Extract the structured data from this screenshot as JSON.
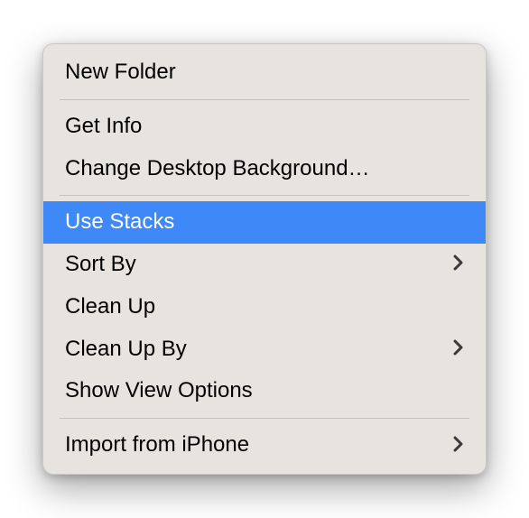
{
  "menu": {
    "items": {
      "new_folder": "New Folder",
      "get_info": "Get Info",
      "change_desktop_background": "Change Desktop Background…",
      "use_stacks": "Use Stacks",
      "sort_by": "Sort By",
      "clean_up": "Clean Up",
      "clean_up_by": "Clean Up By",
      "show_view_options": "Show View Options",
      "import_from_iphone": "Import from iPhone"
    }
  }
}
